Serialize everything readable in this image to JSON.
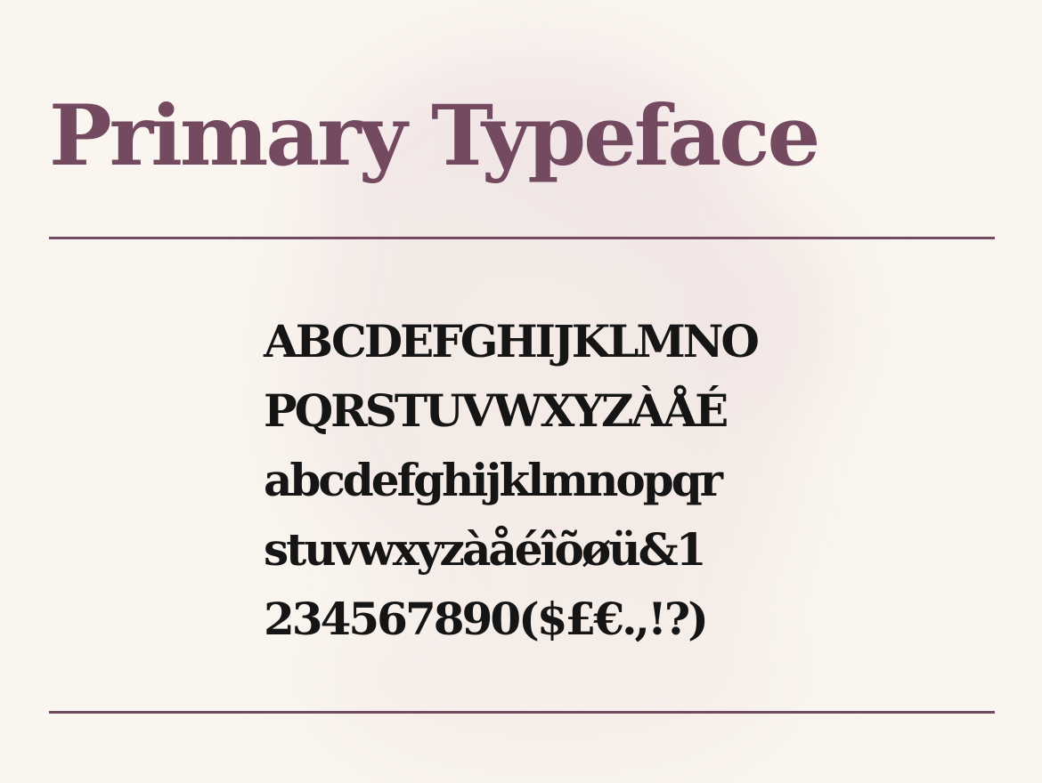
{
  "title": "Primary Typeface",
  "specimen": {
    "lines": [
      "ABCDEFGHIJKLMNO",
      "PQRSTUVWXYZÀÅÉ",
      "abcdefghijklmnopqr",
      "stuvwxyzàåéîõøü&1",
      "234567890($£€.,!?)"
    ]
  },
  "colors": {
    "accent": "#744a61",
    "text": "#151515",
    "background": "#faf5ef"
  }
}
